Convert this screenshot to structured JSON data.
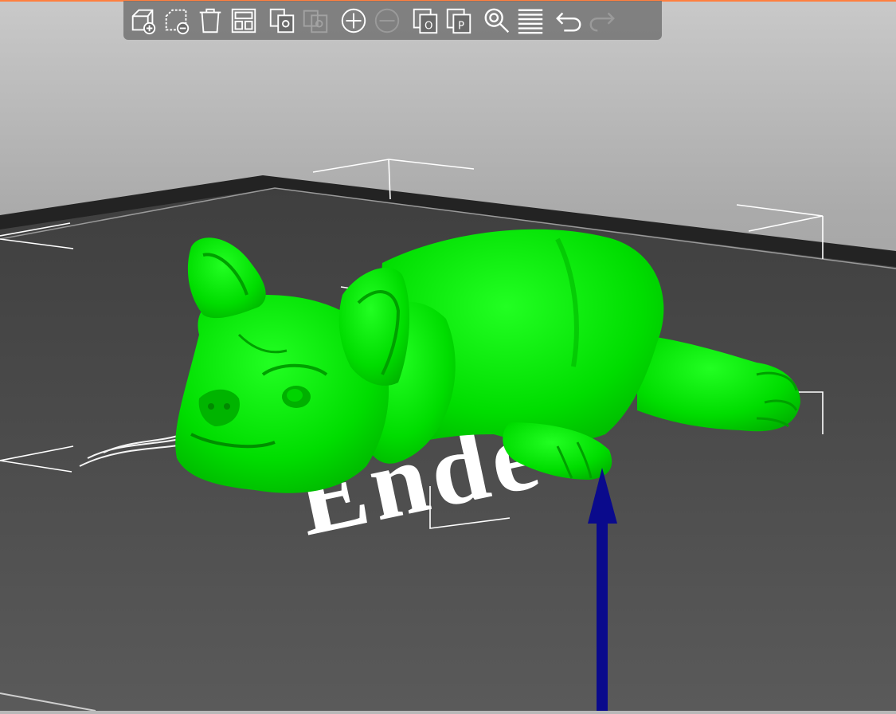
{
  "colors": {
    "accent_top_border": "#ff7f3f",
    "model_green": "#00e000",
    "bed_dark": "#4a4a4a",
    "axis_blue": "#0a0a8c",
    "background_top": "#9a9a9a"
  },
  "toolbar": {
    "items": [
      {
        "icon": "add-object-icon",
        "enabled": true
      },
      {
        "icon": "remove-object-icon",
        "enabled": true
      },
      {
        "icon": "delete-all-icon",
        "enabled": true
      },
      {
        "icon": "arrange-icon",
        "enabled": true
      },
      {
        "icon": "copy-icon",
        "enabled": true
      },
      {
        "icon": "paste-icon",
        "enabled": false
      },
      {
        "icon": "add-instance-icon",
        "enabled": true
      },
      {
        "icon": "remove-instance-icon",
        "enabled": false
      },
      {
        "icon": "split-to-objects-icon",
        "enabled": true
      },
      {
        "icon": "split-to-parts-icon",
        "enabled": true
      },
      {
        "icon": "search-icon",
        "enabled": true
      },
      {
        "icon": "layers-editing-icon",
        "enabled": true
      },
      {
        "icon": "undo-icon",
        "enabled": true
      },
      {
        "icon": "redo-icon",
        "enabled": false
      }
    ]
  },
  "scene": {
    "bed_logo_text": "Ende",
    "model": "french-bulldog-figure"
  }
}
